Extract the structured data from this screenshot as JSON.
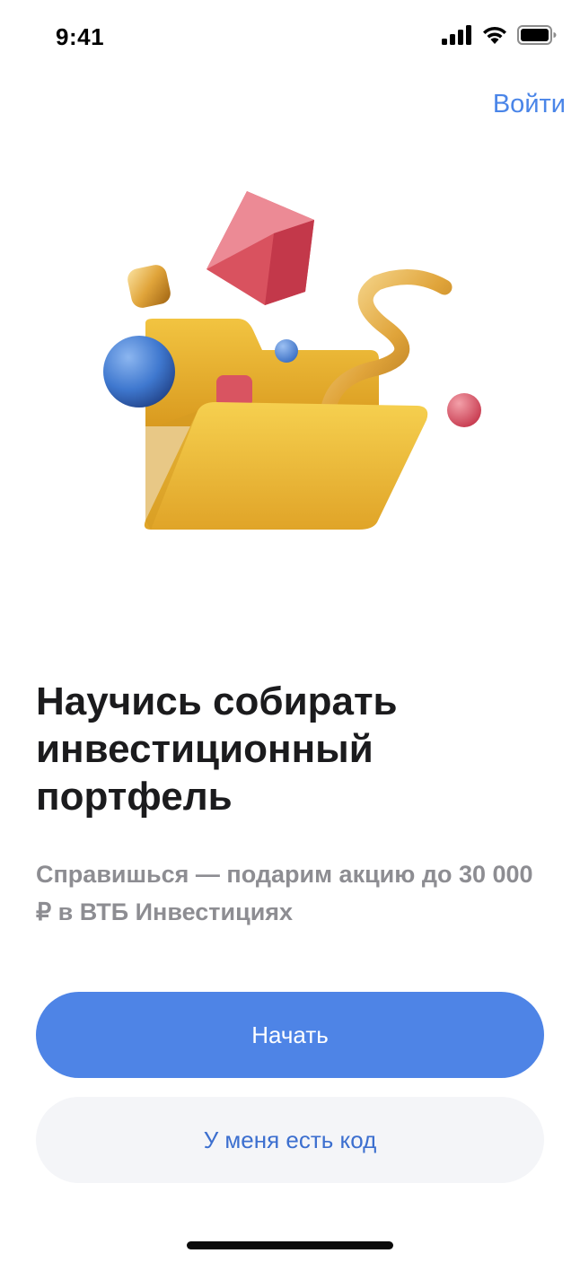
{
  "status_bar": {
    "time": "9:41"
  },
  "header": {
    "signin_label": "Войти"
  },
  "hero": {
    "illustration": "folder-with-shapes-illustration"
  },
  "content": {
    "title": "Научись собирать инвестиционный портфель",
    "subtitle": "Справишься — подарим акцию до 30 000 ₽ в ВТБ Инвестициях"
  },
  "actions": {
    "start_label": "Начать",
    "code_label": "У меня есть код"
  },
  "colors": {
    "accent": "#4e84e6",
    "link": "#4a85e8",
    "secondary_bg": "#f4f5f8",
    "secondary_text": "#3c6fcf"
  }
}
